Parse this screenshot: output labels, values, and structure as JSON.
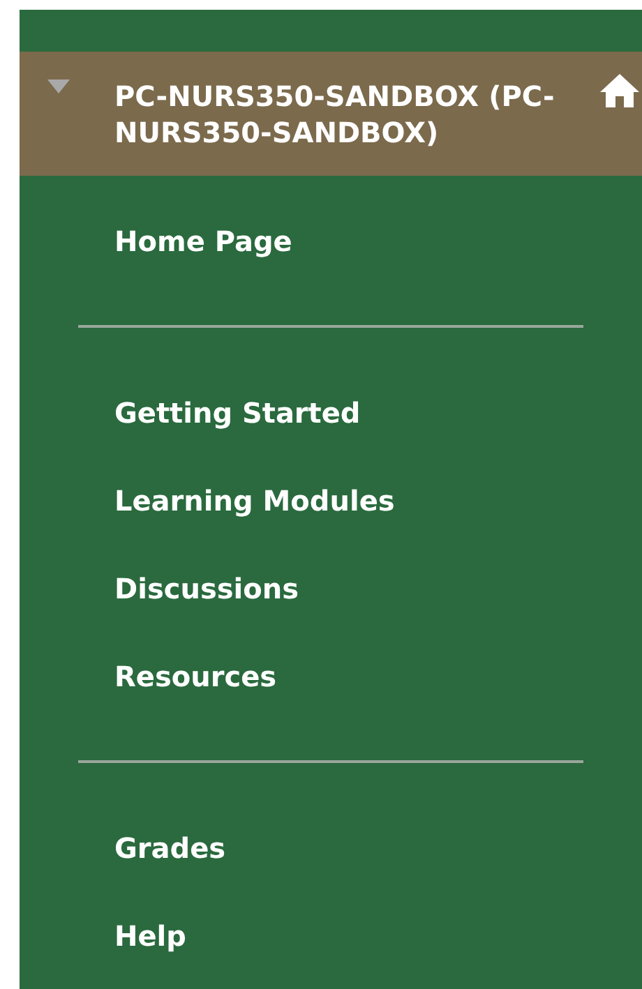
{
  "course": {
    "title": "PC-NURS350-SANDBOX (PC-NURS350-SANDBOX)",
    "expanded": true
  },
  "menu_groups": [
    {
      "items": [
        "Home Page"
      ]
    },
    {
      "items": [
        "Getting Started",
        "Learning Modules",
        "Discussions",
        "Resources"
      ]
    },
    {
      "items": [
        "Grades",
        "Help"
      ]
    }
  ]
}
